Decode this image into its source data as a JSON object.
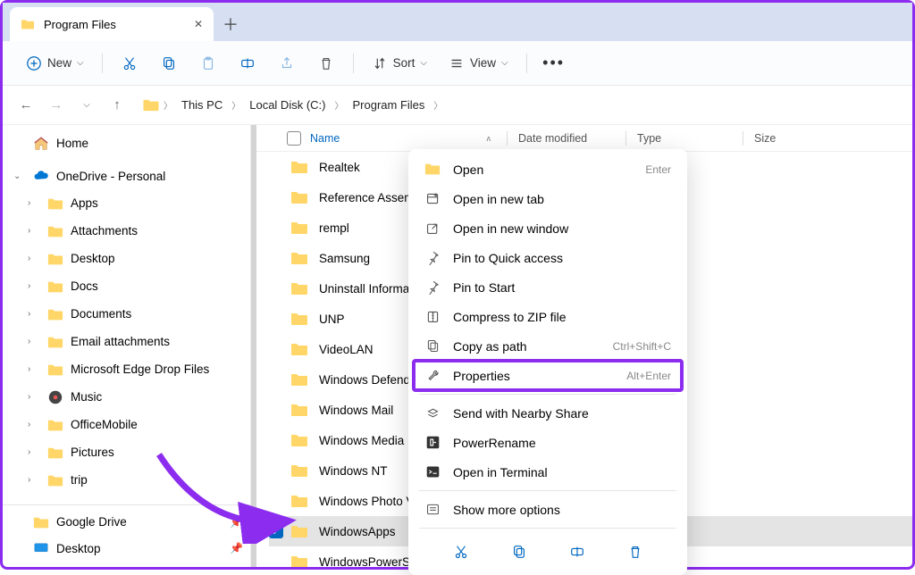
{
  "tab": {
    "title": "Program Files"
  },
  "toolbar": {
    "new_label": "New",
    "sort_label": "Sort",
    "view_label": "View"
  },
  "breadcrumb": {
    "segments": [
      "This PC",
      "Local Disk (C:)",
      "Program Files"
    ]
  },
  "sidebar": {
    "home": "Home",
    "onedrive": "OneDrive - Personal",
    "items": [
      {
        "label": "Apps"
      },
      {
        "label": "Attachments"
      },
      {
        "label": "Desktop"
      },
      {
        "label": "Docs"
      },
      {
        "label": "Documents"
      },
      {
        "label": "Email attachments"
      },
      {
        "label": "Microsoft Edge Drop Files"
      },
      {
        "label": "Music"
      },
      {
        "label": "OfficeMobile"
      },
      {
        "label": "Pictures"
      },
      {
        "label": "trip"
      }
    ],
    "bottom": [
      {
        "label": "Google Drive"
      },
      {
        "label": "Desktop"
      }
    ]
  },
  "columns": {
    "name": "Name",
    "date": "Date modified",
    "type": "Type",
    "size": "Size"
  },
  "files": [
    {
      "name": "Realtek",
      "selected": false
    },
    {
      "name": "Reference Assemblies",
      "selected": false,
      "truncate": 19
    },
    {
      "name": "rempl",
      "selected": false
    },
    {
      "name": "Samsung",
      "selected": false
    },
    {
      "name": "Uninstall Information",
      "selected": false,
      "truncate": 18
    },
    {
      "name": "UNP",
      "selected": false
    },
    {
      "name": "VideoLAN",
      "selected": false
    },
    {
      "name": "Windows Defender",
      "selected": false,
      "truncate": 15
    },
    {
      "name": "Windows Mail",
      "selected": false
    },
    {
      "name": "Windows Media Player",
      "selected": false,
      "truncate": 16
    },
    {
      "name": "Windows NT",
      "selected": false
    },
    {
      "name": "Windows Photo Viewer",
      "selected": false,
      "truncate": 16
    },
    {
      "name": "WindowsApps",
      "selected": true
    },
    {
      "name": "WindowsPowerShell",
      "selected": false,
      "truncate": 15
    }
  ],
  "context_menu": {
    "open": {
      "label": "Open",
      "shortcut": "Enter"
    },
    "open_new_tab": {
      "label": "Open in new tab"
    },
    "open_new_window": {
      "label": "Open in new window"
    },
    "pin_quick": {
      "label": "Pin to Quick access"
    },
    "pin_start": {
      "label": "Pin to Start"
    },
    "compress": {
      "label": "Compress to ZIP file"
    },
    "copy_path": {
      "label": "Copy as path",
      "shortcut": "Ctrl+Shift+C"
    },
    "properties": {
      "label": "Properties",
      "shortcut": "Alt+Enter"
    },
    "nearby": {
      "label": "Send with Nearby Share"
    },
    "powerrename": {
      "label": "PowerRename"
    },
    "terminal": {
      "label": "Open in Terminal"
    },
    "more": {
      "label": "Show more options"
    }
  },
  "annotation": {
    "highlight_item": "properties"
  }
}
